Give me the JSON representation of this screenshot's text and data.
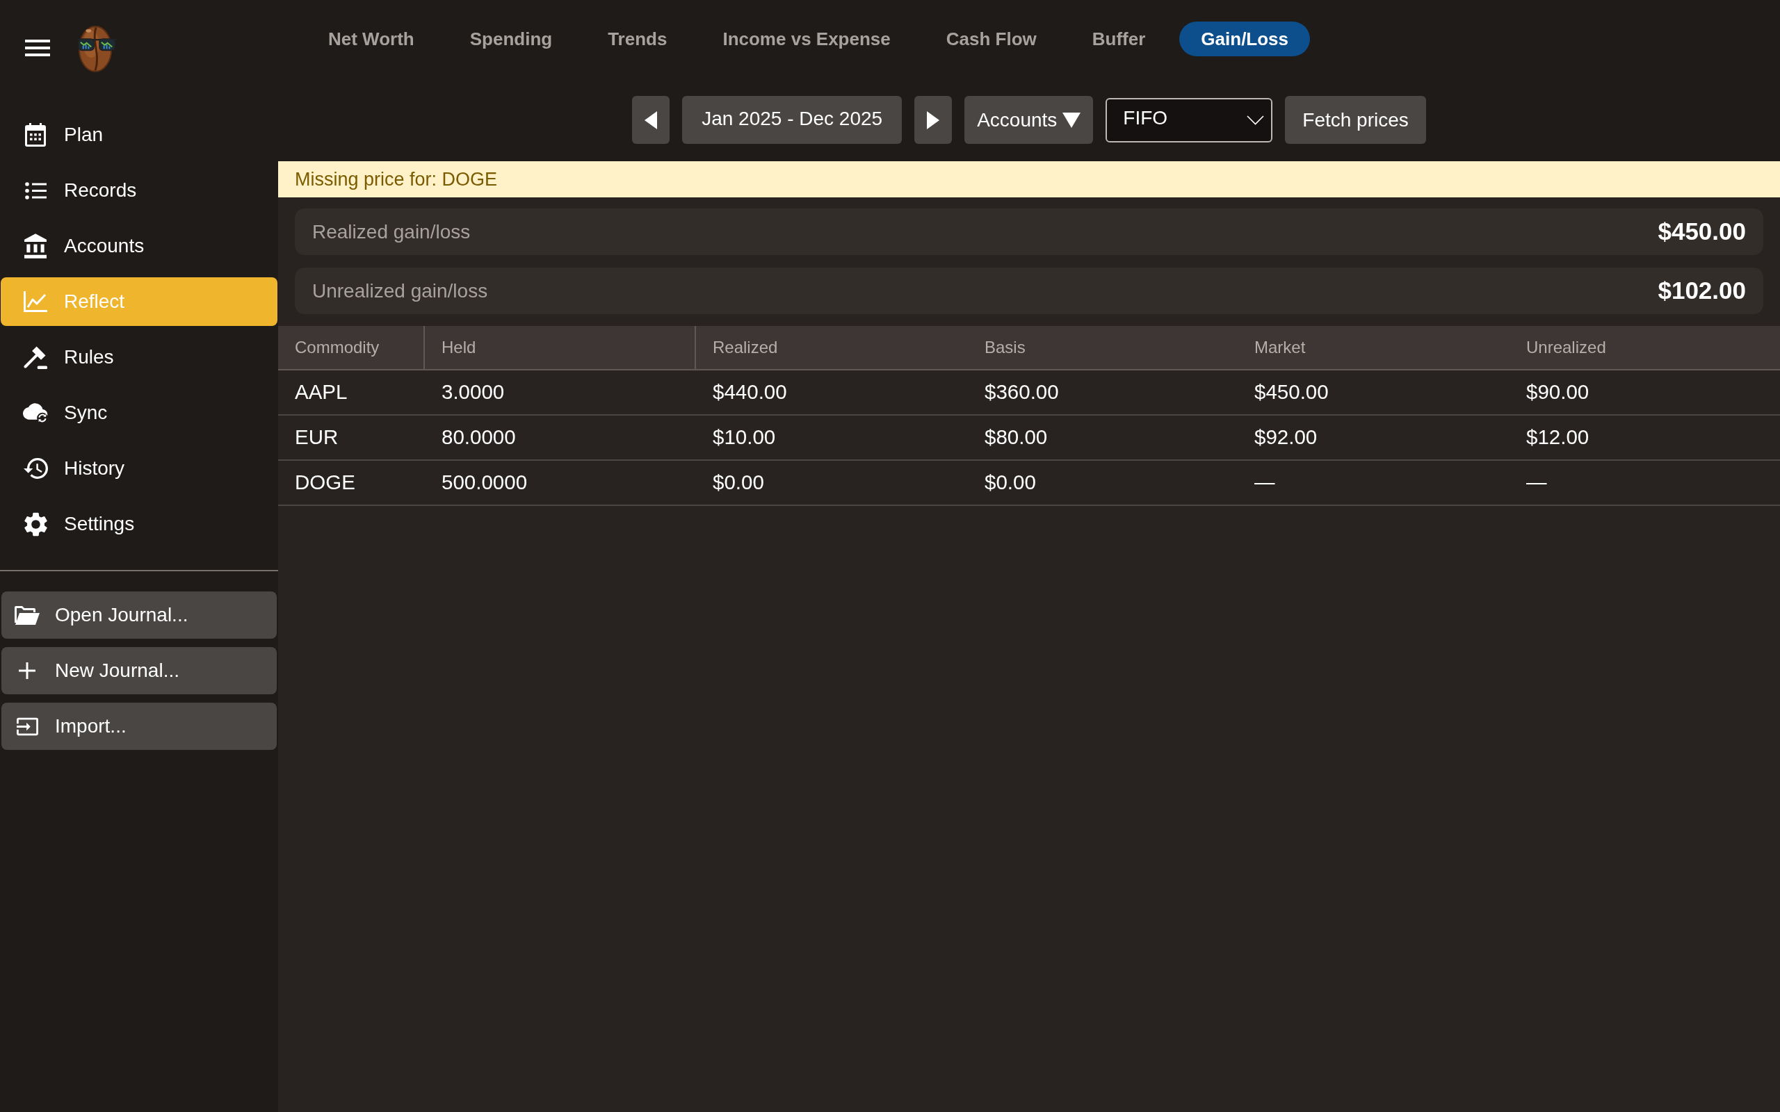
{
  "sidebar": {
    "nav": [
      {
        "label": "Plan",
        "selected": false
      },
      {
        "label": "Records",
        "selected": false
      },
      {
        "label": "Accounts",
        "selected": false
      },
      {
        "label": "Reflect",
        "selected": true
      },
      {
        "label": "Rules",
        "selected": false
      },
      {
        "label": "Sync",
        "selected": false
      },
      {
        "label": "History",
        "selected": false
      },
      {
        "label": "Settings",
        "selected": false
      }
    ],
    "actions": [
      "Open Journal...",
      "New Journal...",
      "Import..."
    ]
  },
  "tabs": [
    {
      "label": "Net Worth",
      "selected": false
    },
    {
      "label": "Spending",
      "selected": false
    },
    {
      "label": "Trends",
      "selected": false
    },
    {
      "label": "Income vs Expense",
      "selected": false
    },
    {
      "label": "Cash Flow",
      "selected": false
    },
    {
      "label": "Buffer",
      "selected": false
    },
    {
      "label": "Gain/Loss",
      "selected": true
    }
  ],
  "toolbar": {
    "date_range": "Jan 2025 - Dec 2025",
    "accounts_filter": "Accounts",
    "cost_method": "FIFO",
    "fetch_button": "Fetch prices"
  },
  "alert": "Missing price for: DOGE",
  "summary": [
    {
      "label": "Realized gain/loss",
      "value": "$450.00"
    },
    {
      "label": "Unrealized gain/loss",
      "value": "$102.00"
    }
  ],
  "table": {
    "columns": [
      "Commodity",
      "Held",
      "Realized",
      "Basis",
      "Market",
      "Unrealized"
    ],
    "rows": [
      [
        "AAPL",
        "3.0000",
        "$440.00",
        "$360.00",
        "$450.00",
        "$90.00"
      ],
      [
        "EUR",
        "80.0000",
        "$10.00",
        "$80.00",
        "$92.00",
        "$12.00"
      ],
      [
        "DOGE",
        "500.0000",
        "$0.00",
        "$0.00",
        "—",
        "—"
      ]
    ]
  }
}
